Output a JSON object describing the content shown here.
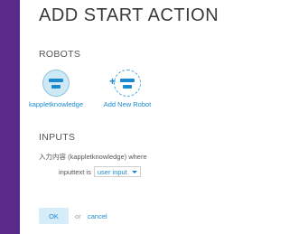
{
  "dialog": {
    "title": "ADD START ACTION"
  },
  "robots": {
    "heading": "ROBOTS",
    "items": [
      {
        "label": "kappletknowledge"
      },
      {
        "label": "Add New Robot"
      }
    ]
  },
  "inputs": {
    "heading": "INPUTS",
    "description": "入力内容 (kappletknowledge) where",
    "field_label": "inputtext is",
    "select_value": "user input"
  },
  "actions": {
    "ok_label": "OK",
    "or_text": "or",
    "cancel_label": "cancel"
  },
  "colors": {
    "sidebar": "#5a2a8a",
    "accent": "#1a8ad0",
    "robot_fill": "#cfe8f5",
    "ok_fill": "#d6ecf8"
  },
  "icons": {
    "robot": "robot-icon",
    "add_robot": "add-robot-icon",
    "dropdown": "chevron-down-icon"
  }
}
